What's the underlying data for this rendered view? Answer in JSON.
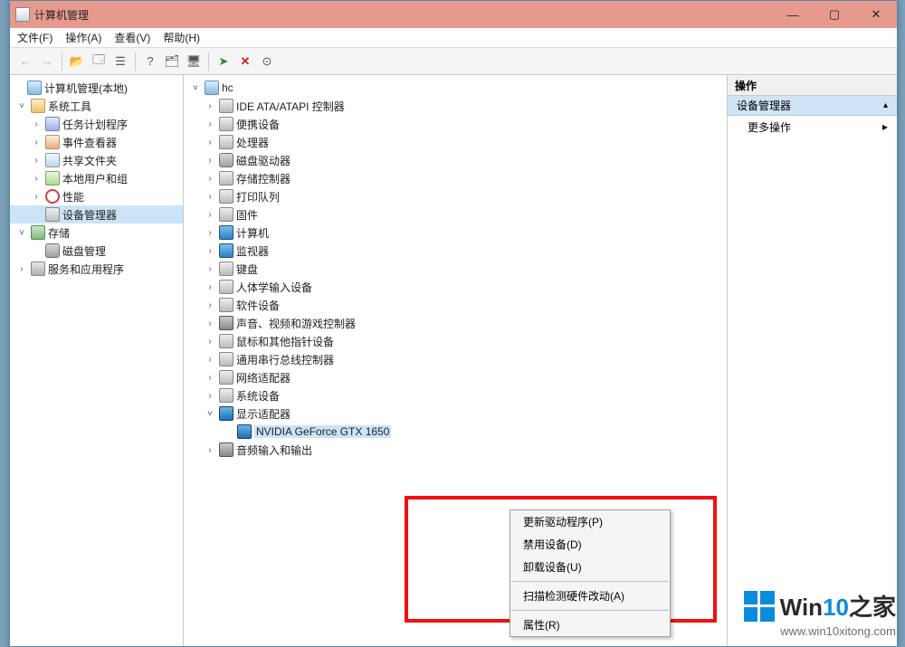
{
  "window": {
    "title": "计算机管理"
  },
  "menus": {
    "file": "文件(F)",
    "action": "操作(A)",
    "view": "查看(V)",
    "help": "帮助(H)"
  },
  "left_tree": {
    "root": "计算机管理(本地)",
    "system_tools": "系统工具",
    "task_scheduler": "任务计划程序",
    "event_viewer": "事件查看器",
    "shared_folders": "共享文件夹",
    "local_users": "本地用户和组",
    "performance": "性能",
    "device_manager": "设备管理器",
    "storage": "存储",
    "disk_mgmt": "磁盘管理",
    "services_apps": "服务和应用程序"
  },
  "devices": {
    "root": "hc",
    "ide": "IDE ATA/ATAPI 控制器",
    "portable": "便携设备",
    "cpu": "处理器",
    "disk_drives": "磁盘驱动器",
    "storage_ctrl": "存储控制器",
    "print_queue": "打印队列",
    "firmware": "固件",
    "computer": "计算机",
    "monitor": "监视器",
    "keyboard": "键盘",
    "hid": "人体学输入设备",
    "software": "软件设备",
    "sound": "声音、视频和游戏控制器",
    "mouse": "鼠标和其他指针设备",
    "usb": "通用串行总线控制器",
    "network": "网络适配器",
    "system": "系统设备",
    "display": "显示适配器",
    "display_item": "NVIDIA GeForce GTX 1650",
    "audio_io": "音频输入和输出"
  },
  "context_menu": {
    "update": "更新驱动程序(P)",
    "disable": "禁用设备(D)",
    "uninstall": "卸载设备(U)",
    "scan": "扫描检测硬件改动(A)",
    "properties": "属性(R)"
  },
  "actions_pane": {
    "header": "操作",
    "band": "设备管理器",
    "more": "更多操作"
  },
  "watermark": {
    "brand_a": "Win",
    "brand_b": "10",
    "brand_c": "之家",
    "url": "www.win10xitong.com"
  }
}
